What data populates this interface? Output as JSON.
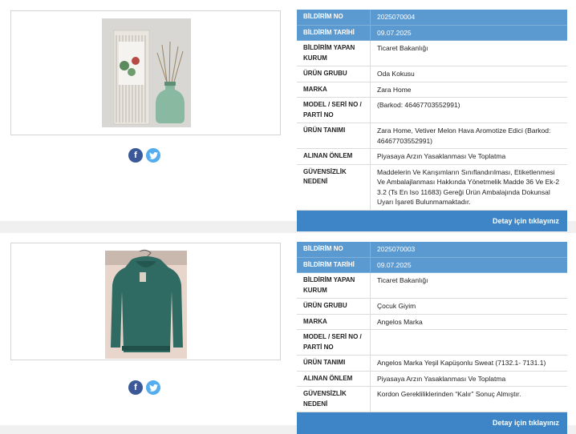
{
  "notices": [
    {
      "labels": {
        "bildirim_no": "BİLDİRİM NO",
        "bildirim_tarihi": "BİLDİRİM TARİHİ",
        "bildirim_yapan_kurum": "BİLDİRİM YAPAN KURUM",
        "urun_grubu": "ÜRÜN GRUBU",
        "marka": "MARKA",
        "model": "MODEL / SERİ NO / PARTİ NO",
        "urun_tanimi": "ÜRÜN TANIMI",
        "alinan_onlem": "ALINAN ÖNLEM",
        "guvensizlik_nedeni": "GÜVENSİZLİK NEDENİ"
      },
      "values": {
        "bildirim_no": "2025070004",
        "bildirim_tarihi": "09.07.2025",
        "bildirim_yapan_kurum": "Ticaret Bakanlığı",
        "urun_grubu": "Oda Kokusu",
        "marka": "Zara Home",
        "model": "(Barkod: 46467703552991)",
        "urun_tanimi": "Zara Home, Vetiver Melon Hava Aromotize Edici (Barkod: 46467703552991)",
        "alinan_onlem": "Piyasaya Arzın Yasaklanması Ve Toplatma",
        "guvensizlik_nedeni": "Maddelerin Ve Karışımların Sınıflandırılması, Etiketlenmesi Ve Ambalajlanması Hakkında Yönetmelik Madde 36 Ve Ek-2 3.2 (Ts En Iso 11683) Gereği Ürün Ambalajında Dokunsal Uyarı İşareti Bulunmamaktadır."
      },
      "detail_link": "Detay için tıklayınız"
    },
    {
      "labels": {
        "bildirim_no": "BİLDİRİM NO",
        "bildirim_tarihi": "BİLDİRİM TARİHİ",
        "bildirim_yapan_kurum": "BİLDİRİM YAPAN KURUM",
        "urun_grubu": "ÜRÜN GRUBU",
        "marka": "MARKA",
        "model": "MODEL / SERİ NO / PARTİ NO",
        "urun_tanimi": "ÜRÜN TANIMI",
        "alinan_onlem": "ALINAN ÖNLEM",
        "guvensizlik_nedeni": "GÜVENSİZLİK NEDENİ"
      },
      "values": {
        "bildirim_no": "2025070003",
        "bildirim_tarihi": "09.07.2025",
        "bildirim_yapan_kurum": "Ticaret Bakanlığı",
        "urun_grubu": "Çocuk Giyim",
        "marka": "Angelos Marka",
        "model": "",
        "urun_tanimi": "Angelos Marka Yeşil Kapüşonlu Sweat (7132.1- 7131.1)",
        "alinan_onlem": "Piyasaya Arzın Yasaklanması Ve Toplatma",
        "guvensizlik_nedeni": "Kordon Gerekliliklerinden “Kalır” Sonuç Almıştır."
      },
      "detail_link": "Detay için tıklayınız"
    }
  ],
  "social": {
    "facebook_icon": "facebook-icon",
    "twitter_icon": "twitter-icon"
  },
  "colors": {
    "header_row": "#5b9ad0",
    "footer_bar": "#3d85c6",
    "facebook": "#3b5998",
    "twitter": "#55acee"
  }
}
